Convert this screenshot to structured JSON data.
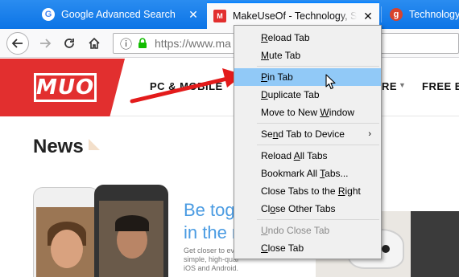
{
  "tabs": [
    {
      "title": "Google Advanced Search",
      "favicon": "G",
      "close": "✕"
    },
    {
      "title": "MakeUseOf - Technology, Simplified",
      "favicon": "M",
      "close": "✕"
    },
    {
      "title": "Technology",
      "favicon": "g"
    }
  ],
  "navbar": {
    "url": "https://www.ma",
    "info_glyph": "ⓘ"
  },
  "site": {
    "logo": "MUO",
    "nav": [
      "PC & MOBILE",
      "RE",
      "FREE E"
    ],
    "caret": "▼",
    "news_heading": "News",
    "promo_title_1": "Be tog",
    "promo_title_2": "in the r",
    "promo_body": [
      "Get closer to ev",
      "simple, high-qual",
      "iOS and Android."
    ]
  },
  "context_menu": {
    "items": [
      {
        "label": "Reload Tab",
        "accel": "R",
        "rest": "eload Tab"
      },
      {
        "label": "Mute Tab",
        "accel": "M",
        "rest": "ute Tab"
      },
      {
        "label": "Pin Tab",
        "accel": "P",
        "rest": "in Tab"
      },
      {
        "label": "Duplicate Tab",
        "accel": "D",
        "rest": "uplicate Tab"
      },
      {
        "label": "Move to New Window",
        "pre": "Move to New ",
        "accel": "W",
        "rest": "indow"
      },
      {
        "label": "Send Tab to Device",
        "pre": "Se",
        "accel": "n",
        "rest": "d Tab to Device",
        "submenu": "›"
      },
      {
        "label": "Reload All Tabs",
        "pre": "Reload ",
        "accel": "A",
        "rest": "ll Tabs"
      },
      {
        "label": "Bookmark All Tabs...",
        "pre": "Bookmark All ",
        "accel": "T",
        "rest": "abs..."
      },
      {
        "label": "Close Tabs to the Right",
        "pre": "Close Tabs to the ",
        "accel": "R",
        "rest": "ight"
      },
      {
        "label": "Close Other Tabs",
        "pre": "Cl",
        "accel": "o",
        "rest": "se Other Tabs"
      },
      {
        "label": "Undo Close Tab",
        "accel": "U",
        "rest": "ndo Close Tab"
      },
      {
        "label": "Close Tab",
        "accel": "C",
        "rest": "lose Tab"
      }
    ]
  },
  "colors": {
    "tab_strip": "#0c74e6",
    "accent_red": "#e22f2f",
    "menu_hover": "#91c9f7",
    "promo_blue": "#4a9be2"
  },
  "icons": [
    "back-arrow-icon",
    "forward-arrow-icon",
    "reload-icon",
    "home-icon",
    "info-icon",
    "lock-icon",
    "close-icon",
    "mouse-cursor-icon",
    "red-pointer-arrow"
  ]
}
